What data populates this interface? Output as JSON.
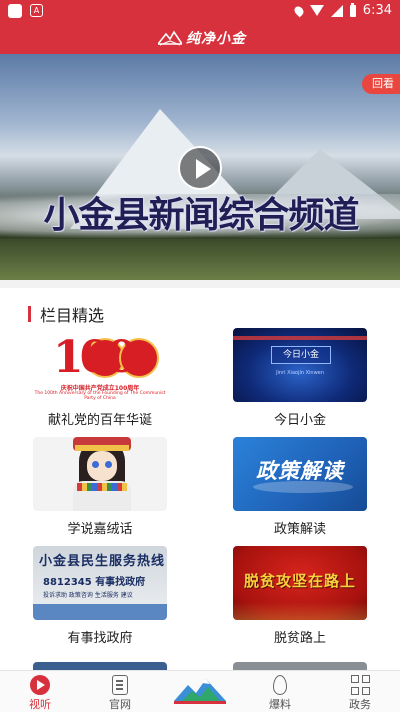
{
  "status_bar": {
    "time": "6:34",
    "notification_icon": "A"
  },
  "header": {
    "brand": "纯净小金"
  },
  "video": {
    "channel_title": "小金县新闻综合频道",
    "replay_label": "回看"
  },
  "section": {
    "title": "栏目精选"
  },
  "programs": [
    {
      "label": "献礼党的百年华诞",
      "thumb": {
        "big_number": "100",
        "year_left": "1921",
        "year_right": "2021",
        "caption": "庆祝中国共产党成立100周年",
        "caption_en": "The 100th Anniversary of the Founding of The Communist Party of China"
      }
    },
    {
      "label": "今日小金",
      "thumb": {
        "box_text": "今日小金",
        "sub": "Jinri Xiaojin Xinwen"
      }
    },
    {
      "label": "学说嘉绒话",
      "thumb": {}
    },
    {
      "label": "政策解读",
      "thumb": {
        "text": "政策解读"
      }
    },
    {
      "label": "有事找政府",
      "thumb": {
        "head": "小金县民生服务热线",
        "phone": "8812345 有事找政府",
        "tiny": "投诉求助 政策咨询 生活服务 建议"
      }
    },
    {
      "label": "脱贫路上",
      "thumb": {
        "text": "脱贫攻坚在路上"
      }
    }
  ],
  "bottom_nav": {
    "items": [
      {
        "label": "视听",
        "icon": "play-icon",
        "active": true
      },
      {
        "label": "官网",
        "icon": "document-icon",
        "active": false
      },
      {
        "label": "",
        "icon": "mountain-logo-icon",
        "active": false
      },
      {
        "label": "爆料",
        "icon": "flame-icon",
        "active": false
      },
      {
        "label": "政务",
        "icon": "grid-icon",
        "active": false
      }
    ]
  },
  "colors": {
    "brand_red": "#d6313c",
    "section_bar": "#d6313c",
    "replay_badge": "#e8463e"
  }
}
